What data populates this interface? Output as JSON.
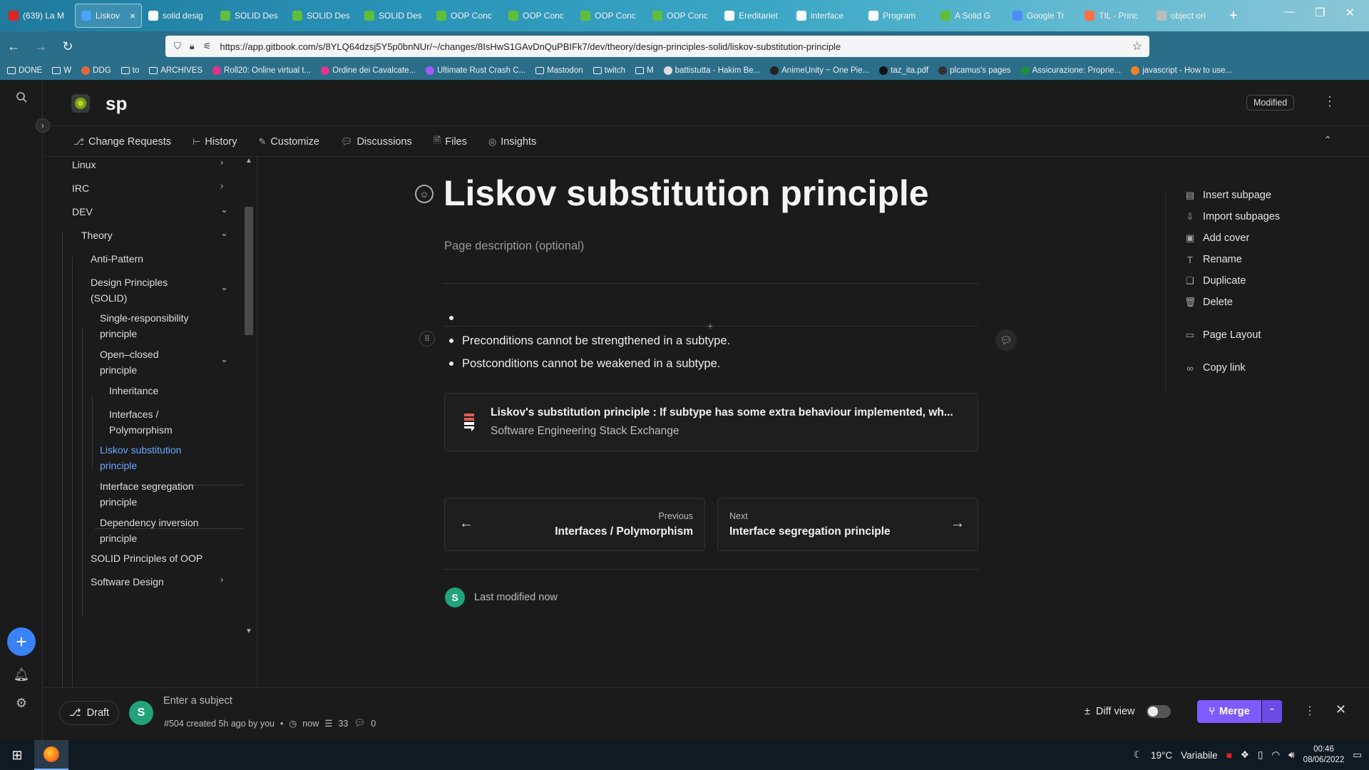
{
  "browser": {
    "tabs": [
      {
        "title": "(639) La M",
        "color": "#e02424"
      },
      {
        "title": "Liskov",
        "color": "#4aa3ff",
        "active": true
      },
      {
        "title": "solid desig",
        "color": "#ffffff"
      },
      {
        "title": "SOLID Des",
        "color": "#5fbf3a"
      },
      {
        "title": "SOLID Des",
        "color": "#5fbf3a"
      },
      {
        "title": "SOLID Des",
        "color": "#5fbf3a"
      },
      {
        "title": "OOP Conc",
        "color": "#5fbf3a"
      },
      {
        "title": "OOP Conc",
        "color": "#5fbf3a"
      },
      {
        "title": "OOP Conc",
        "color": "#5fbf3a"
      },
      {
        "title": "OOP Conc",
        "color": "#5fbf3a"
      },
      {
        "title": "Ereditariet",
        "color": "#ffffff"
      },
      {
        "title": "interface",
        "color": "#ffffff"
      },
      {
        "title": "Program",
        "color": "#ffffff"
      },
      {
        "title": "A Solid G",
        "color": "#5fbf3a"
      },
      {
        "title": "Google Tr",
        "color": "#4a8cff"
      },
      {
        "title": "TIL - Princ",
        "color": "#ff7043"
      },
      {
        "title": "object ori",
        "color": "#bbbbbb"
      }
    ],
    "close_glyph": "×",
    "new_tab_glyph": "+",
    "url": "https://app.gitbook.com/s/8YLQ64dzsj5Y5p0bnNUr/~/changes/8IsHwS1GAvDnQuPBIFk7/dev/theory/design-principles-solid/liskov-substitution-principle",
    "bookmarks": [
      {
        "label": "DONE",
        "type": "folder"
      },
      {
        "label": "W",
        "type": "folder"
      },
      {
        "label": "DDG",
        "type": "dot",
        "color": "#e8663d"
      },
      {
        "label": "to",
        "type": "folder"
      },
      {
        "label": "ARCHIVES",
        "type": "folder"
      },
      {
        "label": "Roll20: Online virtual t...",
        "type": "dot",
        "color": "#e6328a"
      },
      {
        "label": "Ordine dei Cavalcate...",
        "type": "dot",
        "color": "#e6328a"
      },
      {
        "label": "Ultimate Rust Crash C...",
        "type": "dot",
        "color": "#a259ff"
      },
      {
        "label": "Mastodon",
        "type": "folder"
      },
      {
        "label": "twitch",
        "type": "folder"
      },
      {
        "label": "M",
        "type": "folder"
      },
      {
        "label": "battistutta - Hakim Be...",
        "type": "dot",
        "color": "#dddddd"
      },
      {
        "label": "AnimeUnity ~ One Pie...",
        "type": "dot",
        "color": "#222222"
      },
      {
        "label": "taz_ita.pdf",
        "type": "dot",
        "color": "#111111"
      },
      {
        "label": "plcamus's pages",
        "type": "dot",
        "color": "#333333"
      },
      {
        "label": "Assicurazione: Proprie...",
        "type": "dot",
        "color": "#1d8f3a"
      },
      {
        "label": "javascript - How to use...",
        "type": "dot",
        "color": "#f48024"
      }
    ]
  },
  "app": {
    "space_title": "sp",
    "modified_badge": "Modified",
    "nav_tabs": [
      {
        "label": "Change Requests",
        "icon": "branch-icon"
      },
      {
        "label": "History",
        "icon": "history-icon"
      },
      {
        "label": "Customize",
        "icon": "brush-icon"
      },
      {
        "label": "Discussions",
        "icon": "comment-icon"
      },
      {
        "label": "Files",
        "icon": "files-icon"
      },
      {
        "label": "Insights",
        "icon": "insights-icon"
      }
    ],
    "tree": [
      {
        "label": "Linux",
        "chevron": "›"
      },
      {
        "label": "IRC",
        "chevron": "›"
      },
      {
        "label": "DEV",
        "chevron": "⌄"
      },
      {
        "label": "Theory",
        "chevron": "⌄"
      },
      {
        "label": "Anti-Pattern"
      },
      {
        "label": "Design Principles",
        "label2": "(SOLID)",
        "chevron": "⌄"
      },
      {
        "label": "Single-responsibility",
        "label2": "principle"
      },
      {
        "label": "Open–closed",
        "label2": "principle",
        "chevron": "⌄"
      },
      {
        "label": "Inheritance"
      },
      {
        "label": "Interfaces /",
        "label2": "Polymorphism"
      },
      {
        "label": "Liskov substitution",
        "label2": "principle",
        "active": true
      },
      {
        "label": "Interface segregation",
        "label2": "principle"
      },
      {
        "label": "Dependency inversion",
        "label2": "principle"
      },
      {
        "label": "SOLID Principles of OOP"
      },
      {
        "label": "Software Design",
        "chevron": "›"
      }
    ],
    "page": {
      "title": "Liskov substitution principle",
      "description_placeholder": "Page description (optional)",
      "bullets": [
        "",
        "Preconditions cannot be strengthened in a subtype.",
        "Postconditions cannot be weakened in a subtype."
      ],
      "embed": {
        "title": "Liskov's substitution principle : If subtype has some extra behaviour implemented, wh...",
        "source": "Software Engineering Stack Exchange"
      },
      "previous": {
        "caption": "Previous",
        "title": "Interfaces / Polymorphism"
      },
      "next": {
        "caption": "Next",
        "title": "Interface segregation principle"
      },
      "last_modified": "Last modified now",
      "author_initial": "S"
    },
    "actions": [
      {
        "label": "Insert subpage",
        "icon": "subpage-icon"
      },
      {
        "label": "Import subpages",
        "icon": "import-icon"
      },
      {
        "label": "Add cover",
        "icon": "image-icon"
      },
      {
        "label": "Rename",
        "icon": "text-icon"
      },
      {
        "label": "Duplicate",
        "icon": "copy-icon"
      },
      {
        "label": "Delete",
        "icon": "trash-icon"
      },
      {
        "label": "Page Layout",
        "icon": "layout-icon"
      },
      {
        "label": "Copy link",
        "icon": "link-icon"
      }
    ],
    "bottom": {
      "draft_label": "Draft",
      "avatar_initial": "S",
      "subject_placeholder": "Enter a subject",
      "cr_info": "#504 created 5h ago by you",
      "time": "now",
      "lines": "33",
      "comments": "0",
      "diff_view": "Diff view",
      "merge": "Merge"
    }
  },
  "taskbar": {
    "temperature": "19°C",
    "weather": "Variabile",
    "time": "00:46",
    "date": "08/06/2022"
  }
}
